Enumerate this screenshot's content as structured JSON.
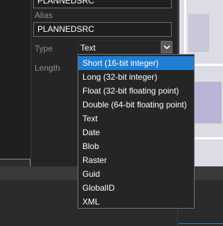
{
  "fields": {
    "name_value": "PLANNEDSRC",
    "alias_label": "Alias",
    "alias_value": "PLANNEDSRC",
    "type_label": "Type",
    "type_value": "Text",
    "length_label": "Length"
  },
  "type_dropdown": {
    "options": [
      "Short (16-bit integer)",
      "Long (32-bit integer)",
      "Float (32-bit floating point)",
      "Double (64-bit floating point)",
      "Text",
      "Date",
      "Blob",
      "Raster",
      "Guid",
      "GlobalID",
      "XML"
    ],
    "highlighted": "Short (16-bit integer)"
  },
  "colors": {
    "accent": "#1f7ed3",
    "background": "#252526",
    "text": "#ffffff",
    "muted_label": "#8e8e8e"
  }
}
